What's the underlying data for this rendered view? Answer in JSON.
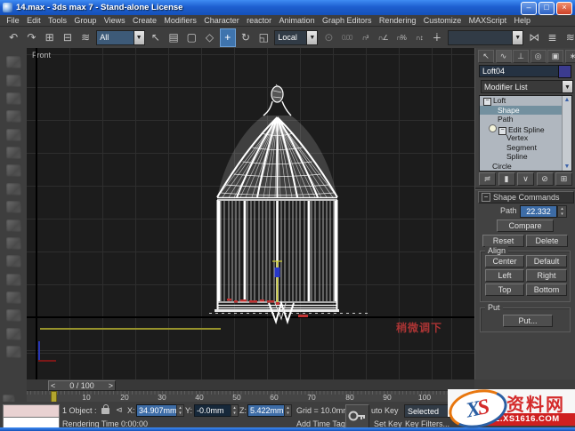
{
  "window": {
    "title": "14.max - 3ds max 7  - Stand-alone License",
    "min": "–",
    "max": "□",
    "close": "×"
  },
  "menu": {
    "items": [
      "File",
      "Edit",
      "Tools",
      "Group",
      "Views",
      "Create",
      "Modifiers",
      "Character",
      "reactor",
      "Animation",
      "Graph Editors",
      "Rendering",
      "Customize",
      "MAXScript",
      "Help"
    ]
  },
  "toolbar": {
    "selection_filter": "All",
    "ref_coord": "Local",
    "icons_a": [
      {
        "n": "undo-icon",
        "g": "↶"
      },
      {
        "n": "redo-icon",
        "g": "↷"
      },
      {
        "n": "select-and-link-icon",
        "g": "⊞"
      },
      {
        "n": "unlink-selection-icon",
        "g": "⊟"
      },
      {
        "n": "bind-to-space-warp-icon",
        "g": "≋"
      }
    ],
    "icons_b": [
      {
        "n": "select-object-icon",
        "g": "↖"
      },
      {
        "n": "select-by-name-icon",
        "g": "▤"
      },
      {
        "n": "rect-selection-region-icon",
        "g": "▢"
      },
      {
        "n": "fence-selection-region-icon",
        "g": "◇"
      }
    ],
    "icons_c": [
      {
        "n": "select-and-move-icon",
        "g": "+"
      },
      {
        "n": "select-and-rotate-icon",
        "g": "↻"
      },
      {
        "n": "select-and-scale-icon",
        "g": "◱"
      }
    ],
    "icons_d": [
      {
        "n": "use-center-icon",
        "g": "⊙"
      },
      {
        "n": "snap-spinner-value-icon",
        "g": "0.00"
      },
      {
        "n": "snaps-toggle-icon",
        "g": "∩³"
      },
      {
        "n": "angle-snap-icon",
        "g": "∩∠"
      },
      {
        "n": "percent-snap-icon",
        "g": "∩%"
      },
      {
        "n": "spinner-snap-icon",
        "g": "∩↕"
      },
      {
        "n": "select-and-manipulate-icon",
        "g": "∔"
      }
    ],
    "icons_e": [
      {
        "n": "mirror-icon",
        "g": "⋈"
      },
      {
        "n": "align-icon",
        "g": "≣"
      },
      {
        "n": "curve-editor-icon",
        "g": "≋"
      }
    ]
  },
  "panel": {
    "object_name": "Loft04",
    "modifier_list": "Modifier List",
    "tabs": [
      {
        "n": "create-tab",
        "g": "↖"
      },
      {
        "n": "modify-tab",
        "g": "∿"
      },
      {
        "n": "hierarchy-tab",
        "g": "⊥"
      },
      {
        "n": "motion-tab",
        "g": "◎"
      },
      {
        "n": "display-tab",
        "g": "▣"
      },
      {
        "n": "utilities-tab",
        "g": "∗"
      }
    ],
    "stack": {
      "rows": [
        {
          "label": "Loft"
        },
        {
          "label": "Shape"
        },
        {
          "label": "Path"
        },
        {
          "label": "Edit Spline"
        },
        {
          "label": "Vertex"
        },
        {
          "label": "Segment"
        },
        {
          "label": "Spline"
        },
        {
          "label": "Circle"
        }
      ]
    },
    "stack_tools": [
      {
        "n": "pin-stack-button",
        "g": "≓"
      },
      {
        "n": "show-end-result-button",
        "g": "▮"
      },
      {
        "n": "make-unique-button",
        "g": "∨"
      },
      {
        "n": "remove-modifier-button",
        "g": "⊘"
      },
      {
        "n": "configure-modifier-sets-button",
        "g": "⊞"
      }
    ],
    "rollout": {
      "title": "Shape Commands",
      "path_label": "Path",
      "path_value": "22.332",
      "compare": "Compare",
      "reset": "Reset",
      "delete": "Delete",
      "align_label": "Align",
      "center": "Center",
      "default": "Default",
      "left": "Left",
      "right": "Right",
      "top": "Top",
      "bottom": "Bottom",
      "put_label": "Put",
      "put": "Put..."
    }
  },
  "viewport": {
    "label": "Front",
    "note": "稍微调下"
  },
  "timeline": {
    "frame": "0 / 100",
    "prev": "<",
    "next": ">",
    "ticks": [
      "10",
      "20",
      "30",
      "40",
      "50",
      "60",
      "70",
      "80",
      "90",
      "100"
    ]
  },
  "status": {
    "objects": "1 Object :",
    "x_label": "X:",
    "x_value": "34.907mm",
    "y_label": "Y:",
    "y_value": "-0.0mm",
    "z_label": "Z:",
    "z_value": "5.422mm",
    "grid": "Grid = 10.0mm",
    "auto_key": "uto Key",
    "key_mode": "Selected",
    "rendering_time": "Rendering Time  0:00:00",
    "add_time_tag": "Add Time Tag",
    "set_key": "Set Key",
    "key_filters": "Key Filters..."
  },
  "watermark": {
    "logo": "XS",
    "site": "资料网",
    "url": "ZL.XS1616.COM"
  }
}
